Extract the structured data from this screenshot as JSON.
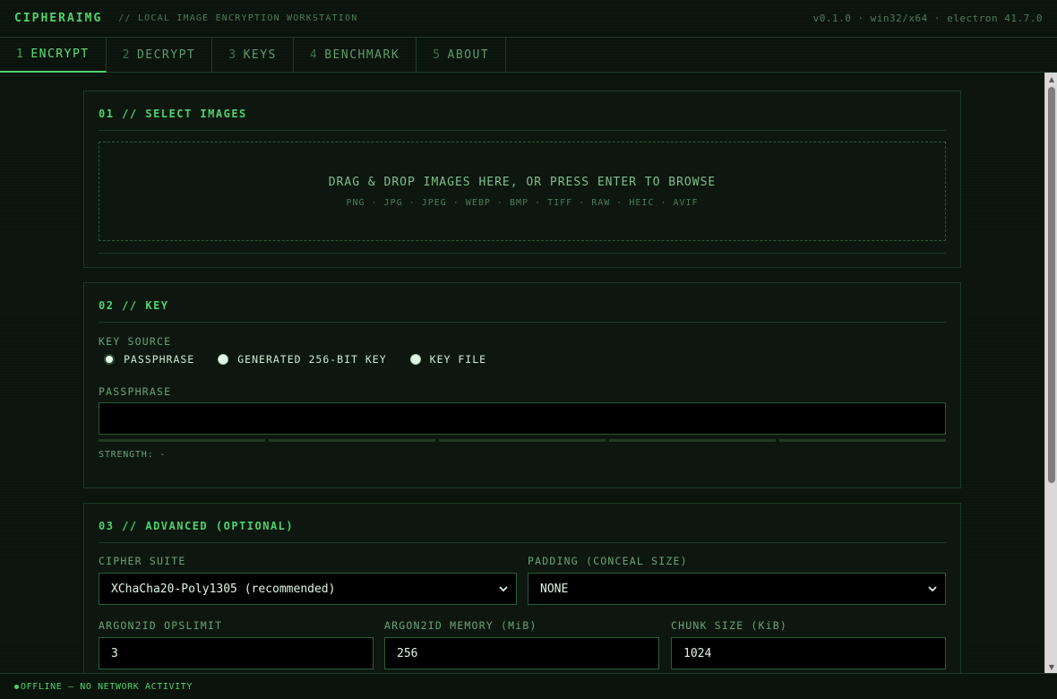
{
  "app": {
    "name": "CIPHERAIMG",
    "subtitle": "// LOCAL IMAGE ENCRYPTION WORKSTATION",
    "version": "v0.1.0 · win32/x64 · electron 41.7.0"
  },
  "tabs": [
    {
      "num": "1",
      "label": "ENCRYPT",
      "active": true
    },
    {
      "num": "2",
      "label": "DECRYPT",
      "active": false
    },
    {
      "num": "3",
      "label": "KEYS",
      "active": false
    },
    {
      "num": "4",
      "label": "BENCHMARK",
      "active": false
    },
    {
      "num": "5",
      "label": "ABOUT",
      "active": false
    }
  ],
  "select_images": {
    "title": "01 // SELECT IMAGES",
    "drop_text": "DRAG & DROP IMAGES HERE, OR PRESS ENTER TO BROWSE",
    "formats": "PNG · JPG · JPEG · WEBP · BMP · TIFF · RAW · HEIC · AVIF"
  },
  "key": {
    "title": "02 // KEY",
    "source_label": "KEY SOURCE",
    "options": [
      {
        "label": "PASSPHRASE",
        "checked": true
      },
      {
        "label": "GENERATED 256-BIT KEY",
        "checked": false
      },
      {
        "label": "KEY FILE",
        "checked": false
      }
    ],
    "passphrase_label": "PASSPHRASE",
    "passphrase_value": "",
    "strength_label": "STRENGTH: -"
  },
  "advanced": {
    "title": "03 // ADVANCED (OPTIONAL)",
    "cipher_label": "CIPHER SUITE",
    "cipher_value": "XChaCha20-Poly1305 (recommended)",
    "padding_label": "PADDING (CONCEAL SIZE)",
    "padding_value": "NONE",
    "ops_label": "ARGON2ID OPSLIMIT",
    "ops_value": "3",
    "memory_label": "ARGON2ID MEMORY (MiB)",
    "memory_value": "256",
    "chunk_label": "CHUNK SIZE (KiB)",
    "chunk_value": "1024"
  },
  "status": {
    "text": "OFFLINE — NO NETWORK ACTIVITY"
  },
  "colors": {
    "accent": "#4fd36a",
    "background": "#0b130d",
    "border": "#1f3a25"
  }
}
